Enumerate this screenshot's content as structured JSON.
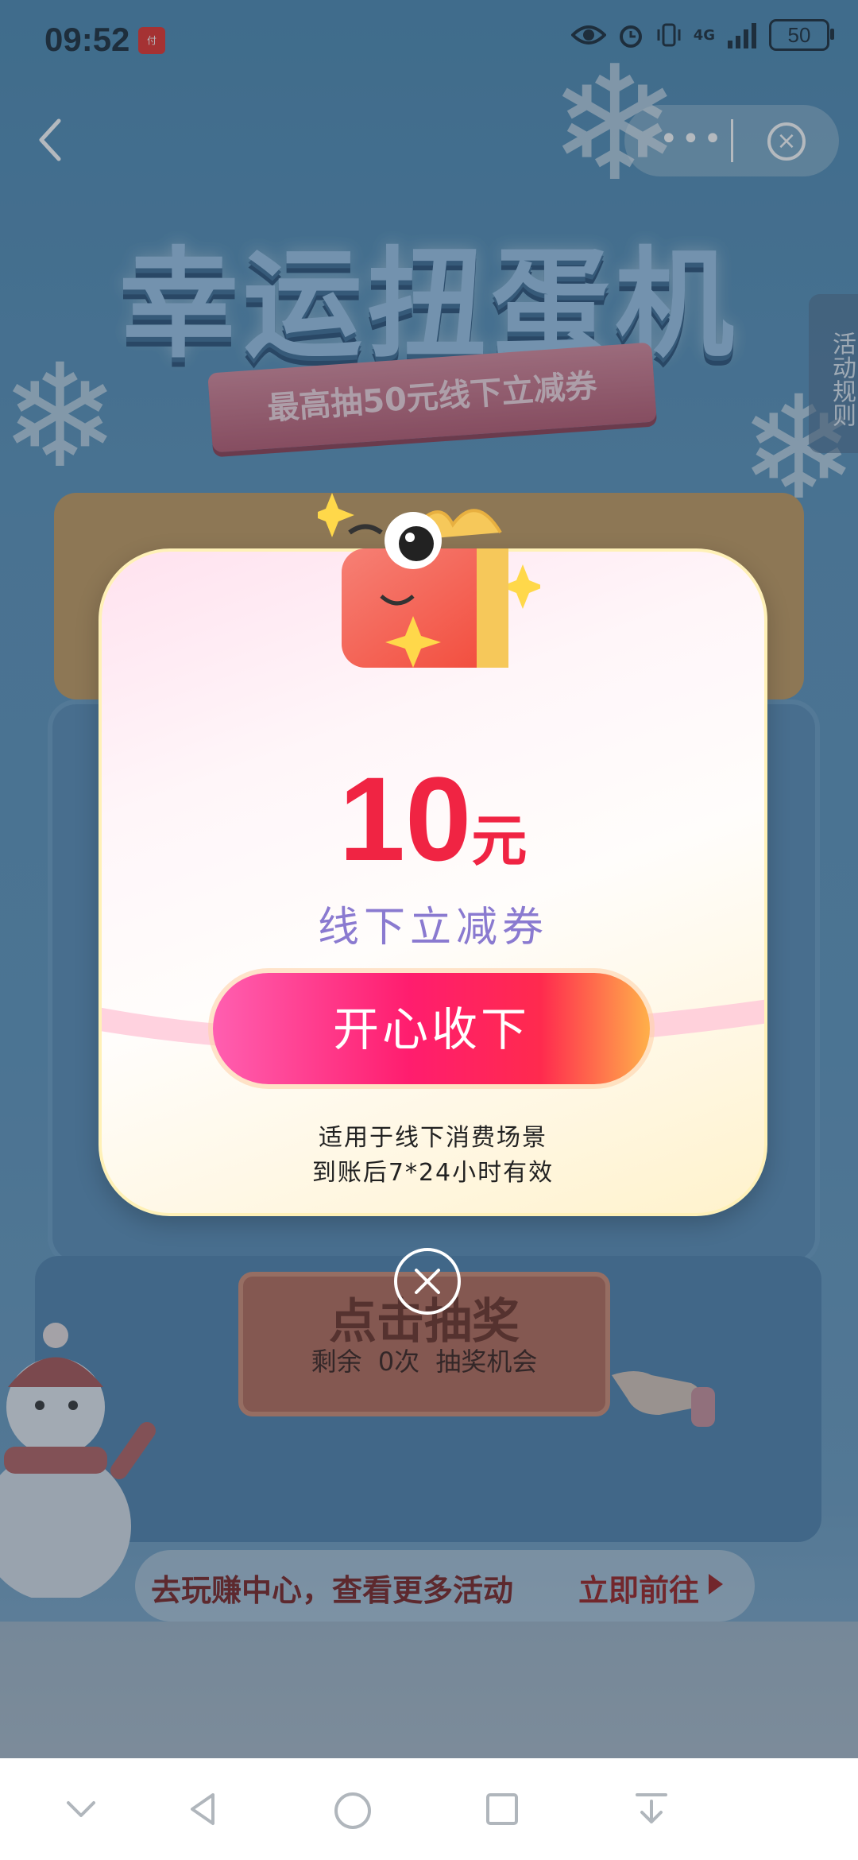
{
  "status_bar": {
    "time": "09:52",
    "app_badge": "云闪付",
    "network": "4G",
    "battery": "50"
  },
  "nav": {
    "back_icon": "chevron-left-icon",
    "more_icon": "more-dots-icon",
    "close_icon": "close-circle-icon"
  },
  "page": {
    "title": "幸运扭蛋机",
    "ribbon": "最高抽50元线下立减券",
    "rules_tab": "活动规则",
    "draw_title": "点击抽奖",
    "remaining_prefix": "剩余",
    "remaining_count": "0次",
    "remaining_suffix": "抽奖机会",
    "bottom_banner_text": "去玩赚中心，查看更多活动",
    "bottom_banner_link": "立即前往"
  },
  "modal": {
    "amount": "10",
    "unit": "元",
    "coupon_type": "线下立减券",
    "accept_button": "开心收下",
    "note_line1": "适用于线下消费场景",
    "note_line2": "到账后7*24小时有效",
    "gift_icon": "gift-box-icon",
    "close_icon": "close-icon"
  },
  "colors": {
    "accent_red": "#f02443",
    "coupon_purple": "#8a7ad0",
    "bg_blue": "#5b93bb"
  },
  "system_nav": {
    "icons": [
      "chevron-down-icon",
      "back-triangle-icon",
      "home-circle-icon",
      "recent-square-icon",
      "download-icon"
    ]
  }
}
